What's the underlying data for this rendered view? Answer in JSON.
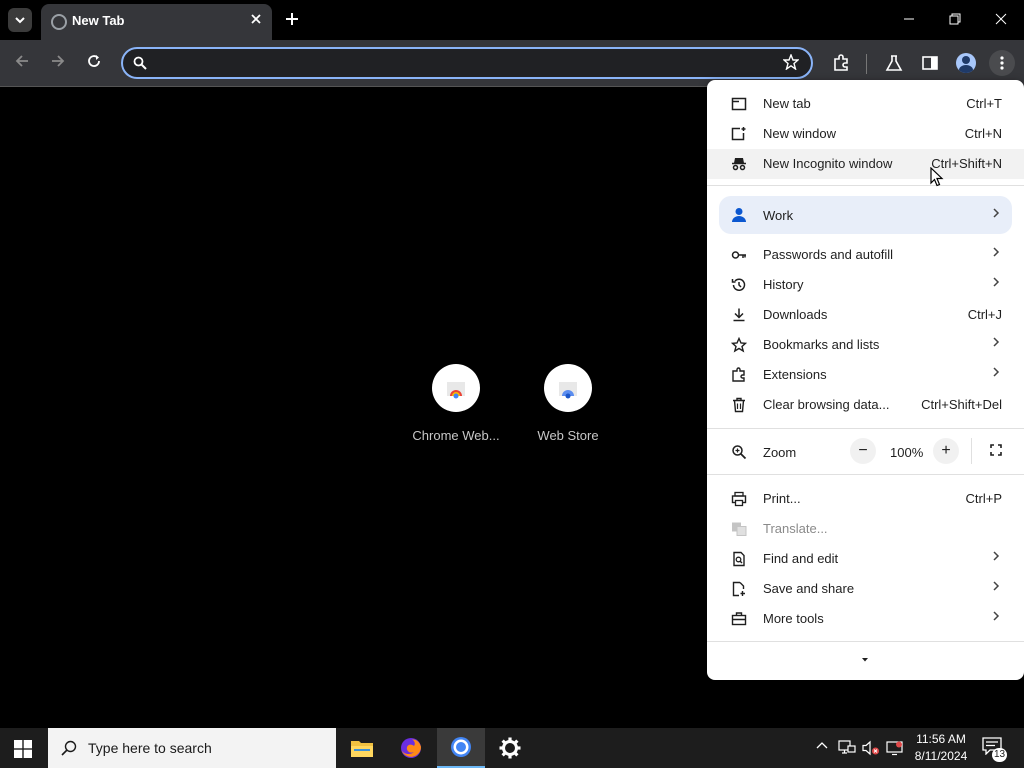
{
  "browser": {
    "tab_title": "New Tab",
    "omnibox_placeholder": ""
  },
  "newtab": {
    "shortcuts": [
      {
        "label": "Chrome Web..."
      },
      {
        "label": "Web Store"
      }
    ]
  },
  "menu": {
    "new_tab": {
      "label": "New tab",
      "shortcut": "Ctrl+T"
    },
    "new_window": {
      "label": "New window",
      "shortcut": "Ctrl+N"
    },
    "incognito": {
      "label": "New Incognito window",
      "shortcut": "Ctrl+Shift+N"
    },
    "profile": {
      "label": "Work"
    },
    "passwords": {
      "label": "Passwords and autofill"
    },
    "history": {
      "label": "History"
    },
    "downloads": {
      "label": "Downloads",
      "shortcut": "Ctrl+J"
    },
    "bookmarks": {
      "label": "Bookmarks and lists"
    },
    "extensions": {
      "label": "Extensions"
    },
    "clear": {
      "label": "Clear browsing data...",
      "shortcut": "Ctrl+Shift+Del"
    },
    "zoom": {
      "label": "Zoom",
      "value": "100%",
      "minus": "−",
      "plus": "+"
    },
    "print": {
      "label": "Print...",
      "shortcut": "Ctrl+P"
    },
    "translate": {
      "label": "Translate..."
    },
    "find": {
      "label": "Find and edit"
    },
    "save": {
      "label": "Save and share"
    },
    "more_tools": {
      "label": "More tools"
    }
  },
  "taskbar": {
    "search_placeholder": "Type here to search",
    "time": "11:56 AM",
    "date": "8/11/2024",
    "notifications": "13"
  },
  "colors": {
    "accent": "#8ab4f8",
    "toolbar": "#35363a",
    "menu_bg": "#ffffff",
    "profile_highlight": "#e8eef9"
  }
}
